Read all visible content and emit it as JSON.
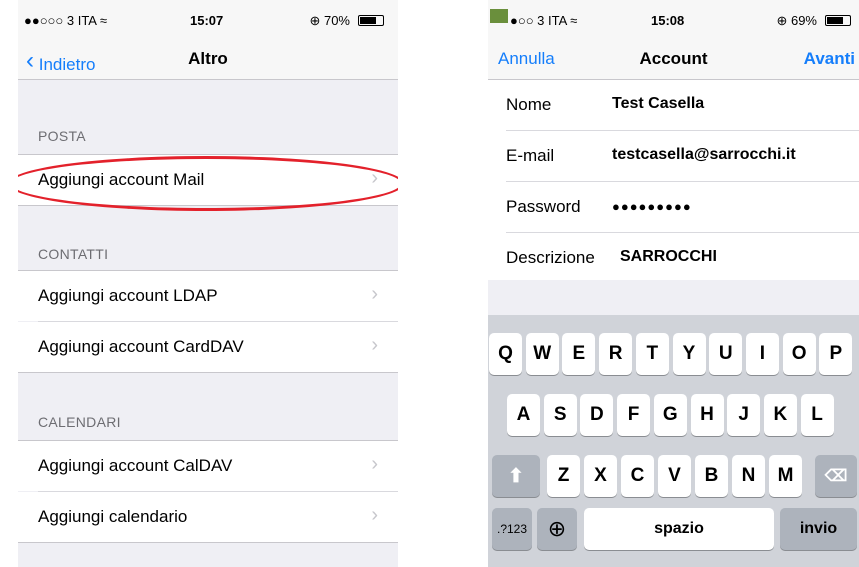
{
  "left": {
    "status": {
      "signal": "●●○○○ 3 ITA ≈",
      "time": "15:07",
      "battery": "⊕ 70%"
    },
    "nav": {
      "back": "Indietro",
      "title": "Altro"
    },
    "sections": [
      {
        "header": "POSTA",
        "items": [
          "Aggiungi account Mail"
        ]
      },
      {
        "header": "CONTATTI",
        "items": [
          "Aggiungi account LDAP",
          "Aggiungi account CardDAV"
        ]
      },
      {
        "header": "CALENDARI",
        "items": [
          "Aggiungi account CalDAV",
          "Aggiungi calendario"
        ]
      }
    ]
  },
  "right": {
    "status": {
      "signal": "●○○ 3 ITA ≈",
      "time": "15:08",
      "battery": "⊕ 69%"
    },
    "nav": {
      "cancel": "Annulla",
      "title": "Account",
      "next": "Avanti"
    },
    "form": [
      {
        "label": "Nome",
        "value": "Test Casella"
      },
      {
        "label": "E-mail",
        "value": "testcasella@sarrocchi.it"
      },
      {
        "label": "Password",
        "value": "●●●●●●●●●"
      },
      {
        "label": "Descrizione",
        "value": "SARROCCHI"
      }
    ],
    "keyboard": {
      "row1": [
        "Q",
        "W",
        "E",
        "R",
        "T",
        "Y",
        "U",
        "I",
        "O",
        "P"
      ],
      "row2": [
        "A",
        "S",
        "D",
        "F",
        "G",
        "H",
        "J",
        "K",
        "L"
      ],
      "row3": [
        "Z",
        "X",
        "C",
        "V",
        "B",
        "N",
        "M"
      ],
      "shift": "⬆",
      "delete": "⌫",
      "numbers": ".?123",
      "globe": "⊕",
      "space": "spazio",
      "return": "invio"
    }
  }
}
